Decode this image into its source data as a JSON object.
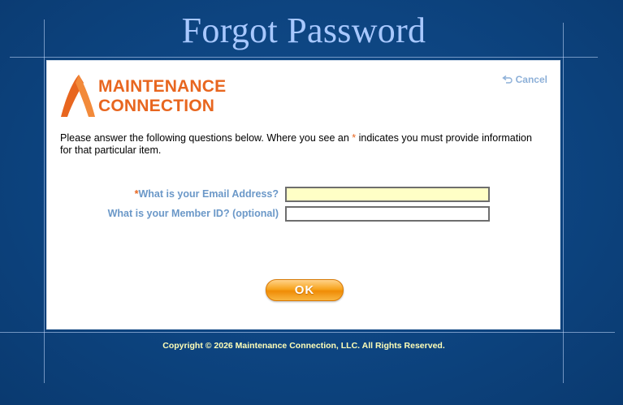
{
  "page": {
    "title": "Forgot Password"
  },
  "header": {
    "logo_line1": "MAINTENANCE",
    "logo_line2": "CONNECTION",
    "cancel_label": "Cancel",
    "cancel_icon": "undo-arrow-icon"
  },
  "form": {
    "instructions_before": "Please answer the following questions below. Where you see an ",
    "required_marker": "*",
    "instructions_after": " indicates you must provide information for that particular item.",
    "email_label": "What is your Email Address?",
    "email_value": "",
    "member_label": "What is your Member ID? (optional)",
    "member_value": "",
    "ok_label": "OK"
  },
  "footer": {
    "copyright": "Copyright © 2026 Maintenance Connection, LLC. All Rights Reserved."
  },
  "colors": {
    "background": "#0b3f78",
    "title": "#a8c8ff",
    "brand_orange": "#e8661f",
    "label_blue": "#6b98c8",
    "required_field_bg": "#ffffc6",
    "footer_text": "#ffffb8"
  }
}
